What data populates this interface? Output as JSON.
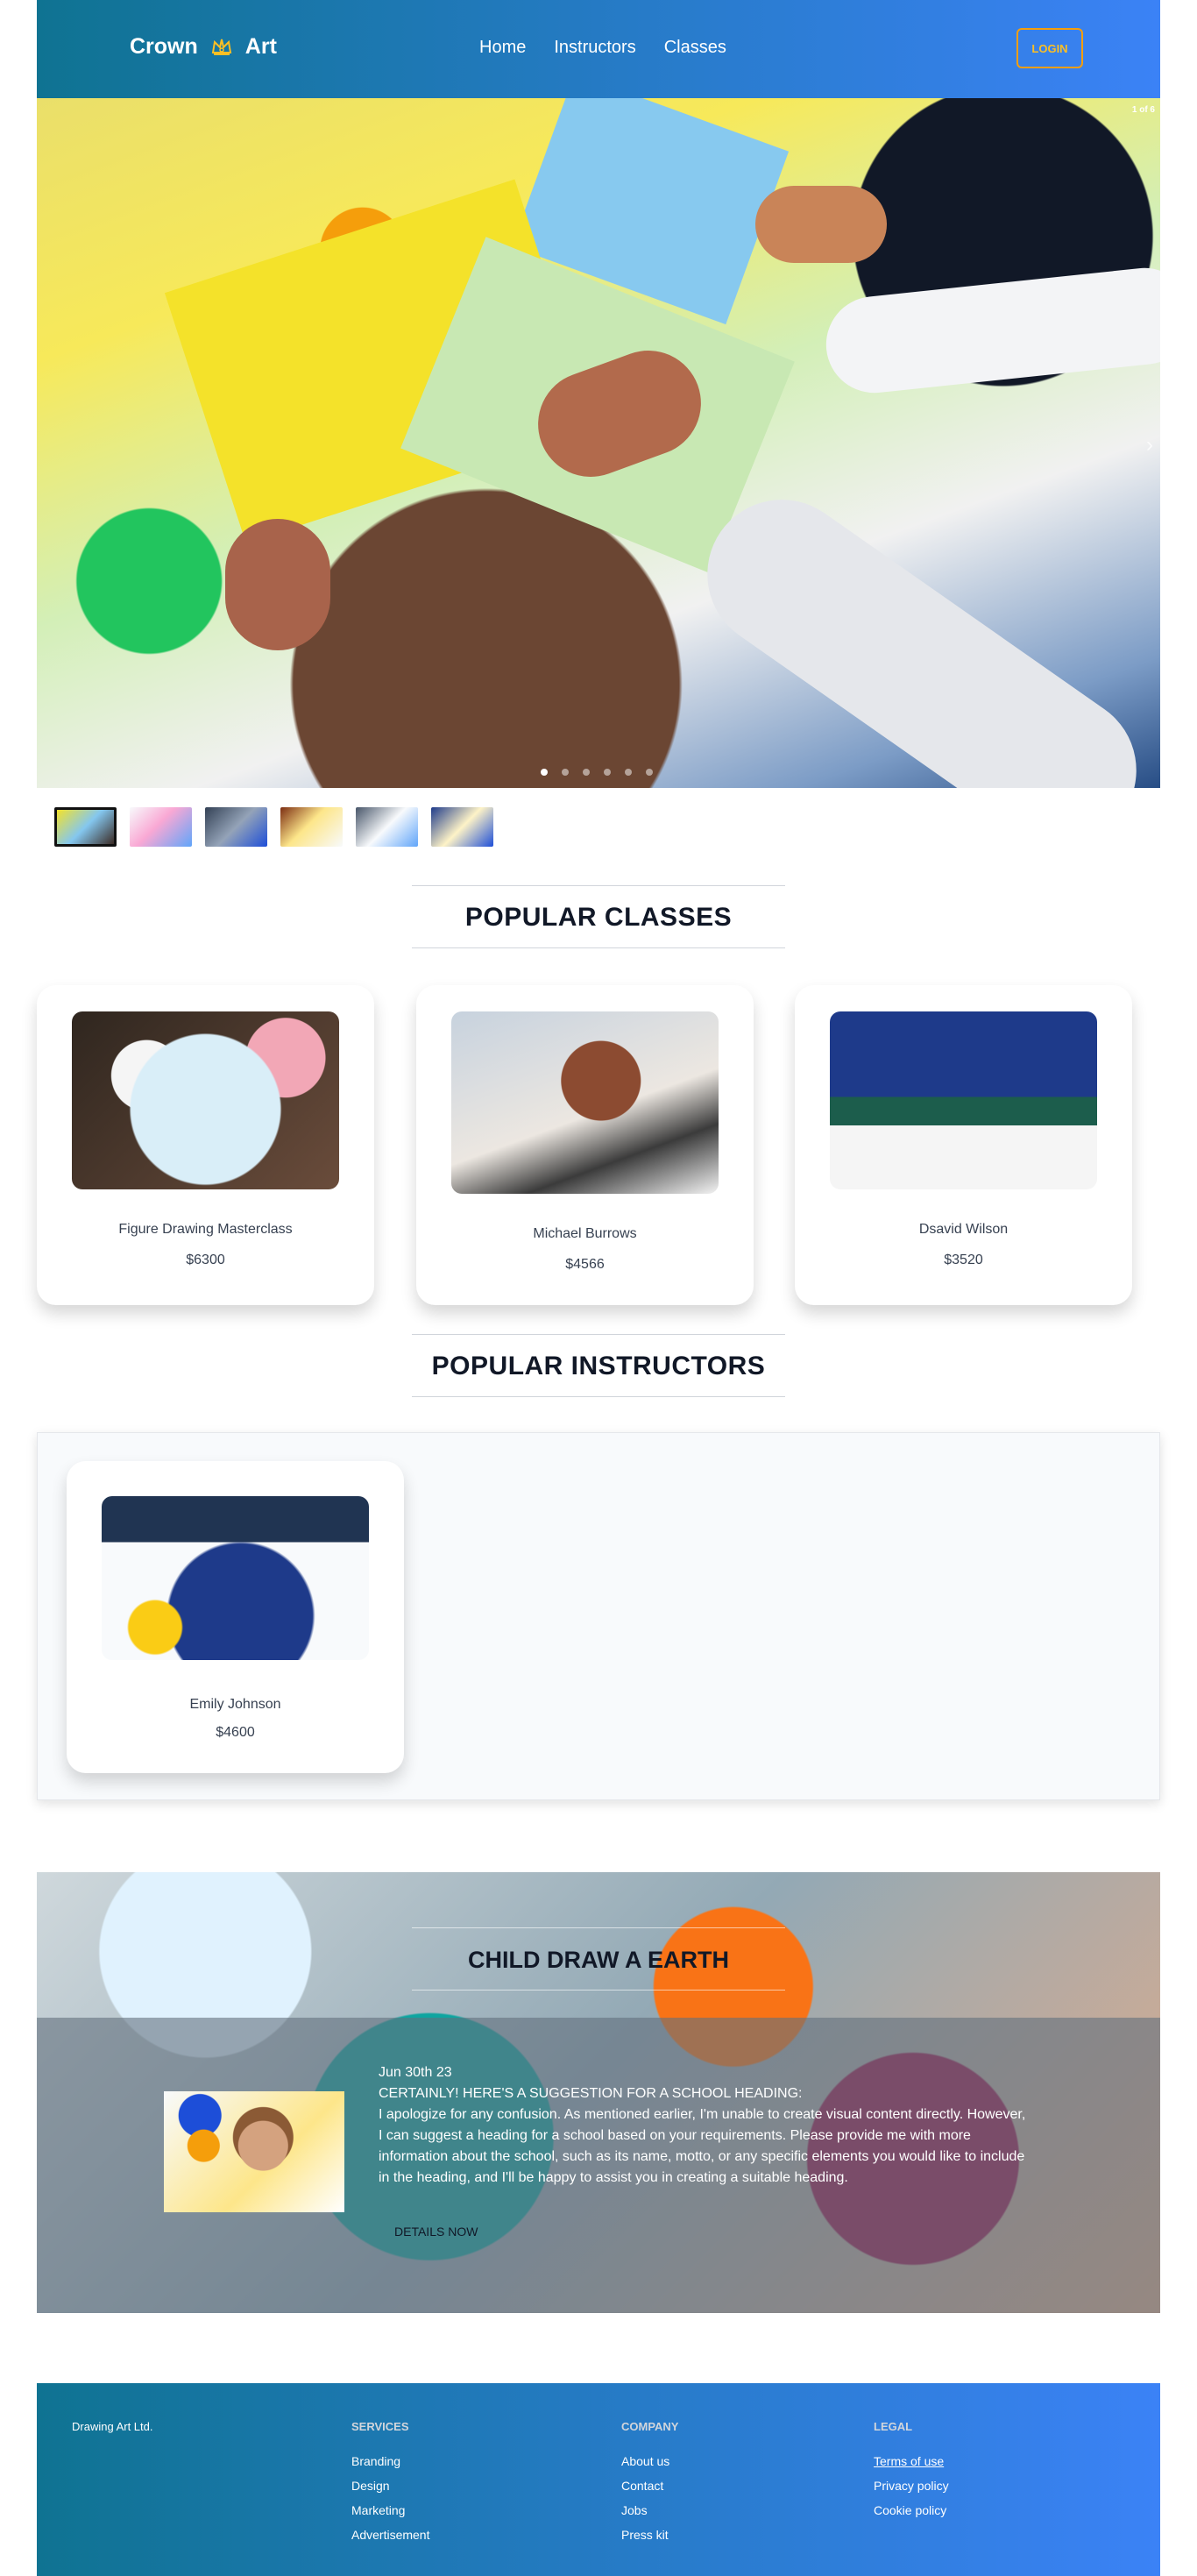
{
  "brand": {
    "name_left": "Crown",
    "name_right": "Art"
  },
  "nav": {
    "items": [
      "Home",
      "Instructors",
      "Classes"
    ],
    "login_label": "LOGIN"
  },
  "carousel": {
    "counter": "1 of 6",
    "active_slide": 1,
    "slide_count": 6
  },
  "sections": {
    "popular_classes": "POPULAR CLASSES",
    "popular_instructors": "POPULAR INSTRUCTORS"
  },
  "classes": [
    {
      "name": "Figure Drawing Masterclass",
      "price": "$6300"
    },
    {
      "name": "Michael Burrows",
      "price": "$4566"
    },
    {
      "name": "Dsavid Wilson",
      "price": "$3520"
    }
  ],
  "instructors": [
    {
      "name": "Emily Johnson",
      "price": "$4600"
    }
  ],
  "banner": {
    "title": "CHILD DRAW A EARTH",
    "date": "Jun 30th 23",
    "heading": "CERTAINLY! HERE'S A SUGGESTION FOR A SCHOOL HEADING:",
    "body": "I apologize for any confusion. As mentioned earlier, I'm unable to create visual content directly. However, I can suggest a heading for a school based on your requirements. Please provide me with more information about the school, such as its name, motto, or any specific elements you would like to include in the heading, and I'll be happy to assist you in creating a suitable heading.",
    "button_label": "DETAILS NOW"
  },
  "footer": {
    "company_name": "Drawing Art Ltd.",
    "services_title": "SERVICES",
    "services": [
      "Branding",
      "Design",
      "Marketing",
      "Advertisement"
    ],
    "company_title": "COMPANY",
    "company_links": [
      "About us",
      "Contact",
      "Jobs",
      "Press kit"
    ],
    "legal_title": "LEGAL",
    "legal_links": [
      "Terms of use",
      "Privacy policy",
      "Cookie policy"
    ]
  },
  "colors": {
    "header_gradient": [
      "#0f7392",
      "#3b82f6"
    ],
    "login_accent": "#f59e0b"
  },
  "icons": [
    "crown-icon",
    "chevron-right-icon"
  ]
}
